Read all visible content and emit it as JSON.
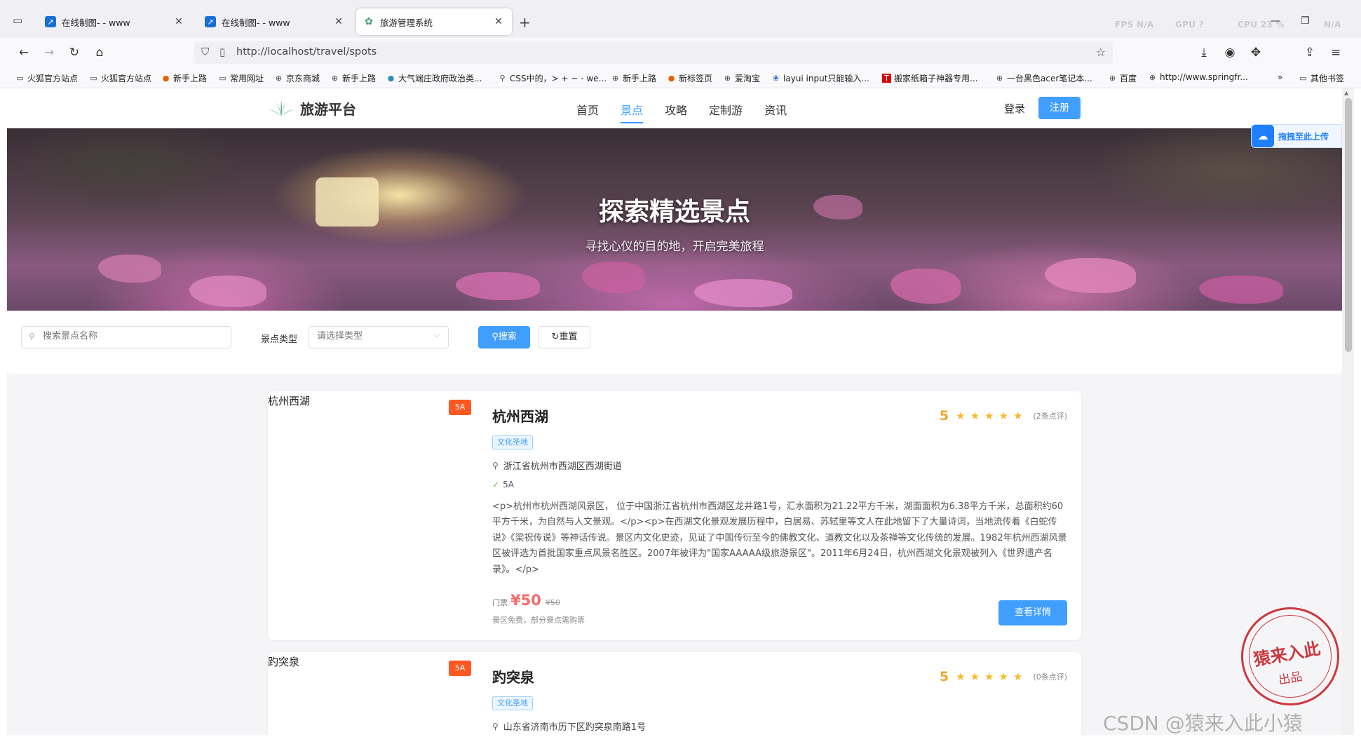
{
  "browser": {
    "tabs": [
      {
        "title": "在线制图- - www",
        "icon": "chart-icon"
      },
      {
        "title": "在线制图- - www",
        "icon": "chart-icon"
      },
      {
        "title": "旅游管理系统",
        "icon": "leaf-icon"
      }
    ],
    "perf": {
      "fps": "FPS N/A",
      "gpu": "GPU ?",
      "cpu": "CPU 23 %",
      "extra": "N/A"
    },
    "url": "http://localhost/travel/spots",
    "bookmarks": [
      "火狐官方站点",
      "火狐官方站点",
      "新手上路",
      "常用网址",
      "京东商城",
      "新手上路",
      "大气端庄政府政治类...",
      "CSS中的，> + ~ - we...",
      "新手上路",
      "新标签页",
      "爱淘宝",
      "layui input只能输入...",
      "搬家纸箱子神器专用...",
      "一台黑色acer笔记本...",
      "百度",
      "http://www.springfr...",
      "其他书签"
    ]
  },
  "site": {
    "logo_text": "旅游平台",
    "nav": [
      "首页",
      "景点",
      "攻略",
      "定制游",
      "资讯"
    ],
    "active_nav": "景点",
    "login": "登录",
    "register": "注册"
  },
  "hero": {
    "title": "探索精选景点",
    "subtitle": "寻找心仪的目的地，开启完美旅程"
  },
  "filter": {
    "search_placeholder": "搜索景点名称",
    "type_label": "景点类型",
    "type_placeholder": "请选择类型",
    "search_btn": "搜索",
    "reset_btn": "重置"
  },
  "spots": [
    {
      "img_alt": "杭州西湖",
      "badge": "5A",
      "name": "杭州西湖",
      "score": "5",
      "stars": "★★★★★",
      "reviews": "(2条点评)",
      "tag": "文化圣地",
      "address": "浙江省杭州市西湖区西湖街道",
      "level": "5A",
      "desc": "<p>杭州市杭州西湖风景区， 位于中国浙江省杭州市西湖区龙井路1号，汇水面积为21.22平方千米，湖面面积为6.38平方千米，总面积约60平方千米，为自然与人文景观。</p><p>在西湖文化景观发展历程中，白居易、苏轼里等文人在此地留下了大量诗词，当地流传着《白蛇传说》《梁祝传说》等神话传说。景区内文化史迹，见证了中国传衍至今的佛教文化、道教文化以及茶禅等文化传统的发展。1982年杭州西湖风景区被评选为首批国家重点风景名胜区。2007年被评为\"国家AAAAA级旅游景区\"。2011年6月24日，杭州西湖文化景观被列入《世界遗产名录》。</p>",
      "price_label": "门票",
      "price": "¥50",
      "orig_price": "¥50",
      "note": "景区免费，部分景点需购票",
      "detail_btn": "查看详情"
    },
    {
      "img_alt": "趵突泉",
      "badge": "5A",
      "name": "趵突泉",
      "score": "5",
      "stars": "★★★★★",
      "reviews": "(0条点评)",
      "tag": "文化圣地",
      "address": "山东省济南市历下区趵突泉南路1号"
    }
  ],
  "overlays": {
    "upload_text": "拖拽至此上传",
    "stamp_big": "猿来入此",
    "stamp_small": "出品",
    "watermark": "CSDN @猿来入此小猿"
  },
  "colors": {
    "accent": "#409eff",
    "price": "#f56c6c",
    "star": "#f7ba2a",
    "badge": "#ff5722"
  }
}
